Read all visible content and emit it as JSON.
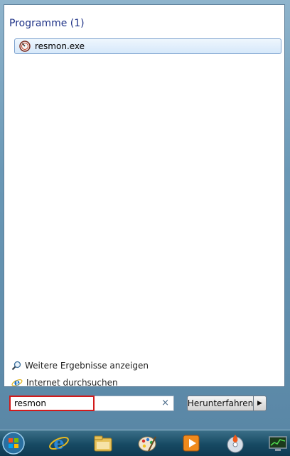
{
  "start_menu": {
    "group_title": "Programme (1)",
    "results": [
      {
        "label": "resmon.exe",
        "icon": "resource-monitor-icon"
      }
    ],
    "more_results_label": "Weitere Ergebnisse anzeigen",
    "internet_search_label": "Internet durchsuchen",
    "search": {
      "value": "resmon",
      "clear_symbol": "×"
    },
    "shutdown_label": "Herunterfahren",
    "shutdown_arrow": "▶"
  },
  "taskbar": {
    "items": [
      {
        "name": "start-orb-icon"
      },
      {
        "name": "internet-explorer-icon"
      },
      {
        "name": "windows-explorer-icon"
      },
      {
        "name": "paint-icon"
      },
      {
        "name": "media-player-icon"
      },
      {
        "name": "disc-burner-icon"
      },
      {
        "name": "resource-monitor-icon"
      }
    ]
  },
  "colors": {
    "highlight_border": "#d21a1a",
    "group_title": "#1e3287",
    "selected_item_bg": "#d6e8fa"
  }
}
